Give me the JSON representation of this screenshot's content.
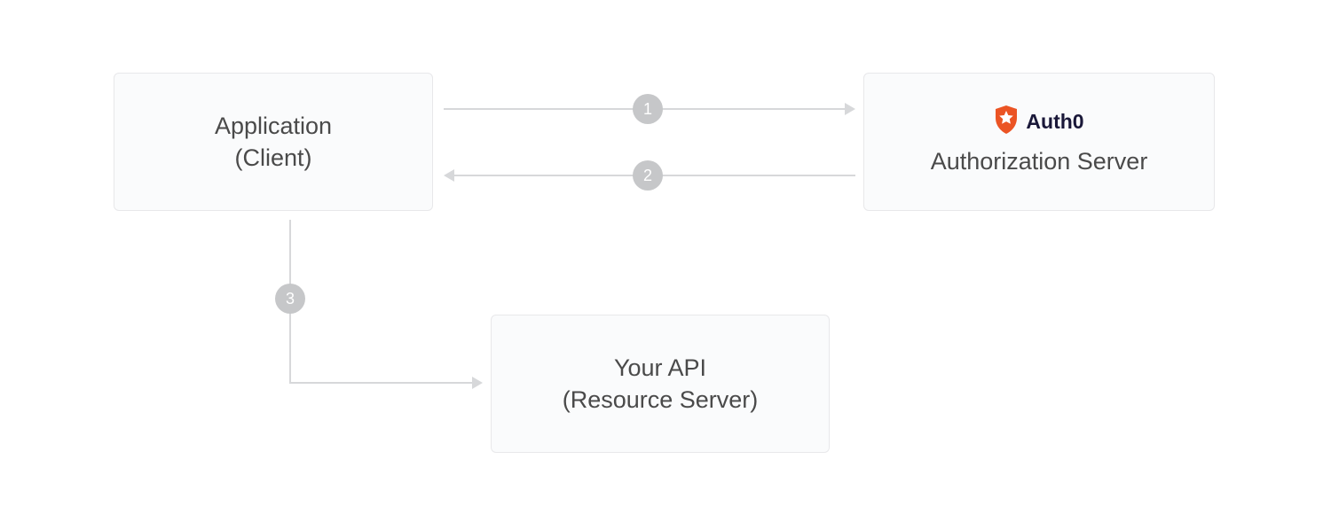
{
  "boxes": {
    "client": {
      "line1": "Application",
      "line2": "(Client)"
    },
    "authserver": {
      "brand": "Auth0",
      "label": "Authorization Server"
    },
    "api": {
      "line1": "Your API",
      "line2": "(Resource Server)"
    }
  },
  "steps": {
    "one": "1",
    "two": "2",
    "three": "3"
  },
  "colors": {
    "boxBg": "#fafbfc",
    "boxBorder": "#e8e8ea",
    "text": "#4a4a4a",
    "arrow": "#d7d8da",
    "badge": "#c6c7c9",
    "brandOrange": "#eb5424",
    "brandWhite": "#ffffff",
    "brandText": "#1a1839"
  }
}
